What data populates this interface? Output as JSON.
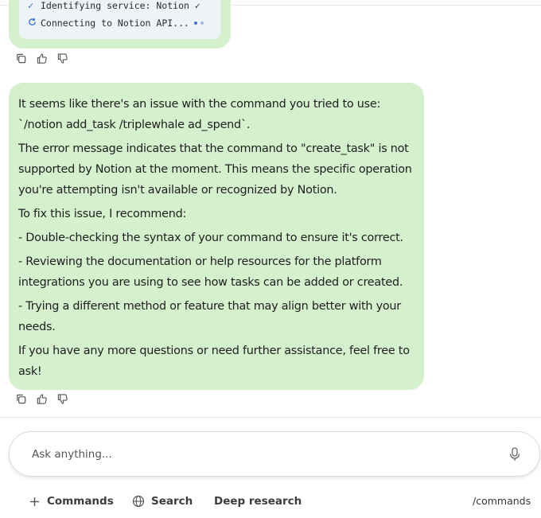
{
  "previous_message": {
    "status_lines": [
      {
        "icon": "check-icon",
        "text": "Identifying service: Notion ✓"
      },
      {
        "icon": "refresh-icon",
        "text": "Connecting to Notion API..."
      }
    ]
  },
  "response": {
    "paragraphs": [
      "It seems like there's an issue with the command you tried to use: `/notion add_task /triplewhale ad_spend`.",
      "The error message indicates that the command to \"create_task\" is not supported by Notion at the moment. This means the specific operation you're attempting isn't available or recognized by Notion.",
      "To fix this issue, I recommend:",
      "- Double-checking the syntax of your command to ensure it's correct.",
      "- Reviewing the documentation or help resources for the platform integrations you are using to see how tasks can be added or created.",
      "- Trying a different method or feature that may align better with your needs.",
      "If you have any more questions or need further assistance, feel free to ask!"
    ]
  },
  "message_actions": {
    "icons": [
      "copy-icon",
      "thumbs-up-icon",
      "thumbs-down-icon"
    ]
  },
  "input": {
    "placeholder": "Ask anything...",
    "value": "",
    "mic_icon": "microphone-icon"
  },
  "toolbar": {
    "commands_label": "Commands",
    "search_label": "Search",
    "deep_research_label": "Deep research",
    "slash_commands_label": "/commands"
  },
  "colors": {
    "bubble_bg": "#d5f0cd",
    "status_box_bg": "#eef3f8",
    "accent_blue": "#3f72d6"
  }
}
